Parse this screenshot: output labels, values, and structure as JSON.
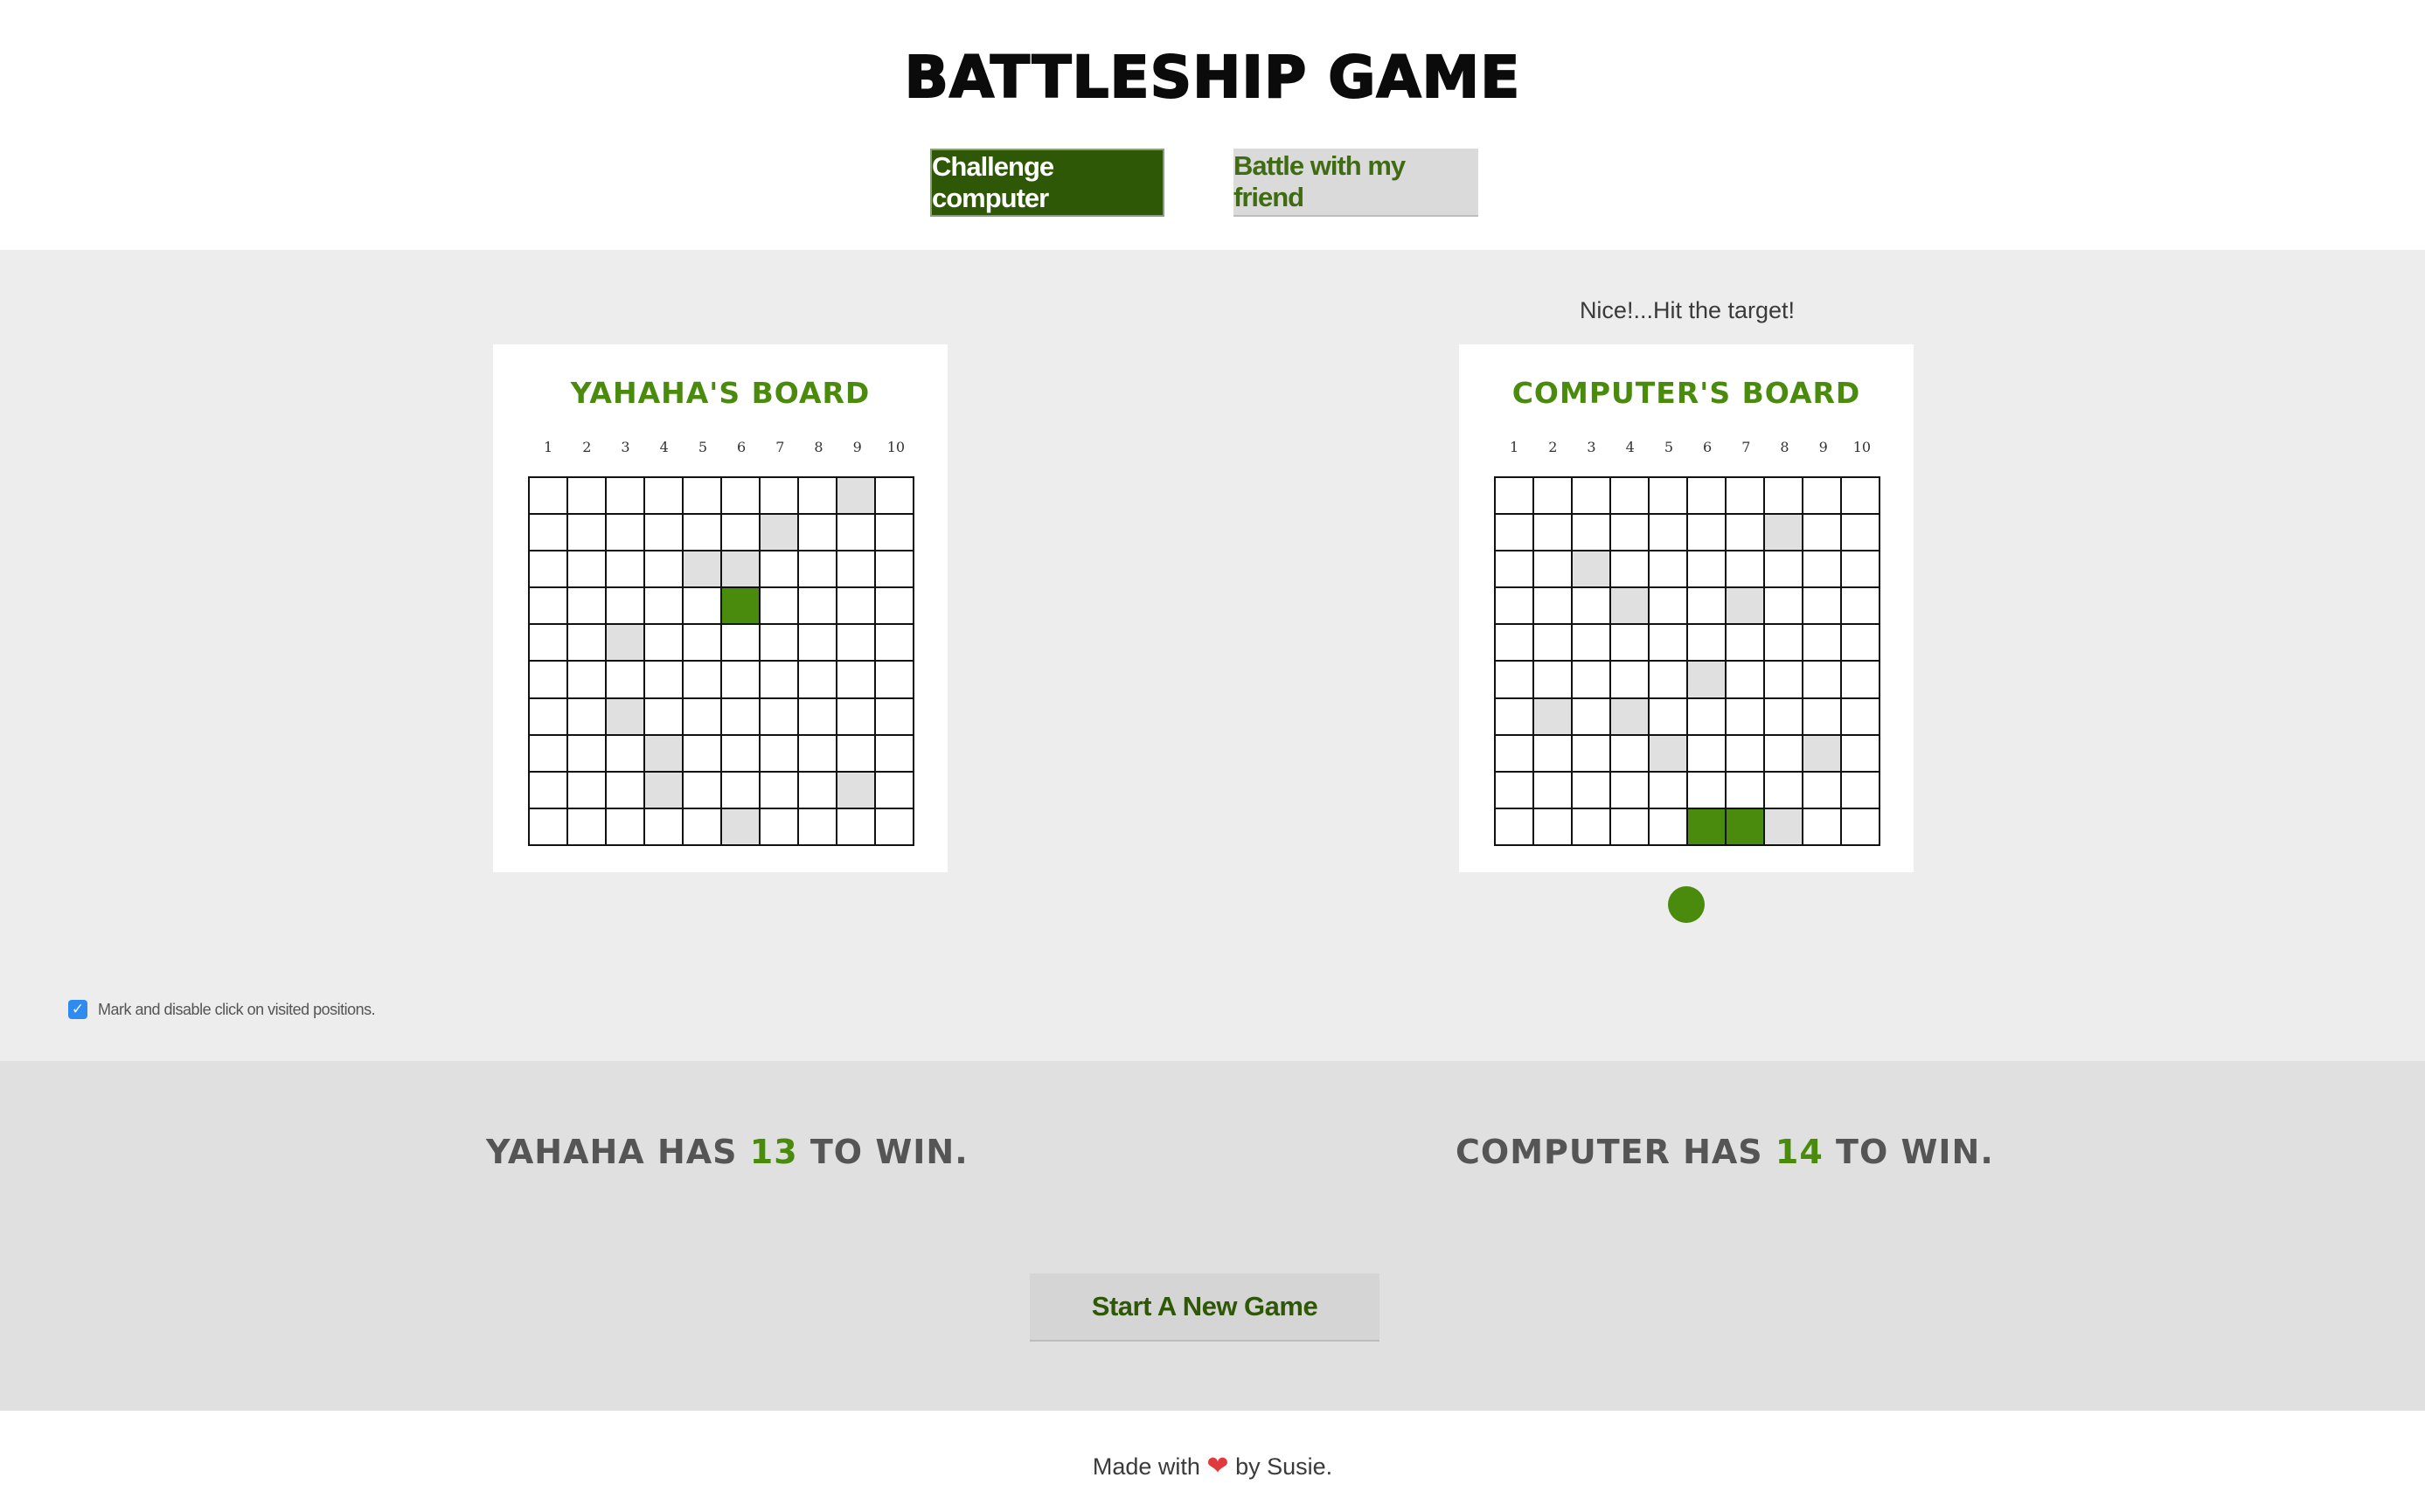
{
  "header": {
    "title": "BATTLESHIP GAME",
    "mode_buttons": {
      "challenge": "Challenge computer",
      "friend": "Battle with my friend"
    }
  },
  "status_message": "Nice!...Hit the target!",
  "column_labels": [
    "1",
    "2",
    "3",
    "4",
    "5",
    "6",
    "7",
    "8",
    "9",
    "10"
  ],
  "boards": {
    "player": {
      "title": "YAHAHA'S BOARD",
      "cells": [
        "..........",
        "........m.",
        "......m...",
        "....mm....",
        ".....H....",
        "..m.......",
        "..........",
        "..m.......",
        "...m......",
        "...m....m.",
        ".....m...."
      ]
    },
    "computer": {
      "title": "COMPUTER'S BOARD",
      "cells": [
        "..........",
        "..........",
        ".......m..",
        "..m.......",
        "...m..m...",
        "..........",
        ".....m....",
        ".m.m......",
        "....m...m.",
        "..........",
        ".....HHm.."
      ]
    }
  },
  "options": {
    "mark_visited_label": "Mark and disable click on visited positions.",
    "mark_visited_checked": true
  },
  "scores": {
    "player": {
      "prefix": "YAHAHA HAS ",
      "count": "13",
      "suffix": " TO WIN."
    },
    "computer": {
      "prefix": "COMPUTER HAS ",
      "count": "14",
      "suffix": " TO WIN."
    }
  },
  "new_game_label": "Start A New Game",
  "footer": {
    "before": "Made with ",
    "heart": "❤",
    "after": " by Susie."
  },
  "colors": {
    "hit": "#4a8a0d",
    "miss": "#e0e0e0",
    "active_button": "#2e5706",
    "arena_bg": "#ededed"
  }
}
